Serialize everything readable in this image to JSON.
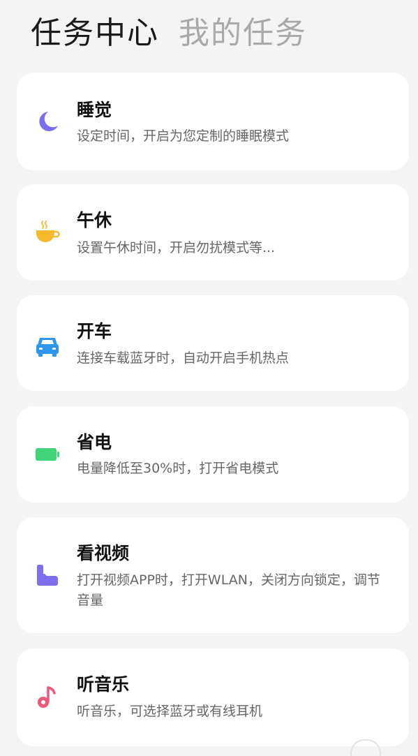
{
  "header": {
    "tabs": [
      {
        "label": "任务中心",
        "active": true
      },
      {
        "label": "我的任务",
        "active": false
      }
    ]
  },
  "tasks": [
    {
      "title": "睡觉",
      "description": "设定时间，开启为您定制的睡眠模式",
      "icon": "moon-star-icon",
      "icon_color": "#7b6cf2"
    },
    {
      "title": "午休",
      "description": "设置午休时间，开启勿扰模式等...",
      "icon": "coffee-cup-icon",
      "icon_color": "#f5b92e"
    },
    {
      "title": "开车",
      "description": "连接车载蓝牙时，自动开启手机热点",
      "icon": "car-icon",
      "icon_color": "#2f96ee"
    },
    {
      "title": "省电",
      "description": "电量降低至30%时，打开省电模式",
      "icon": "battery-icon",
      "icon_color": "#3fd47a"
    },
    {
      "title": "看视频",
      "description": "打开视频APP时，打开WLAN，关闭方向锁定，调节音量",
      "icon": "video-tablet-icon",
      "icon_color": "#7f6ef0"
    },
    {
      "title": "听音乐",
      "description": "听音乐，可选择蓝牙或有线耳机",
      "icon": "music-note-icon",
      "icon_color": "#f0587a"
    }
  ],
  "colors": {
    "background": "#f4f4f4",
    "card": "#ffffff",
    "active_tab": "#1a1a1a",
    "inactive_tab": "#a9a9a9"
  }
}
